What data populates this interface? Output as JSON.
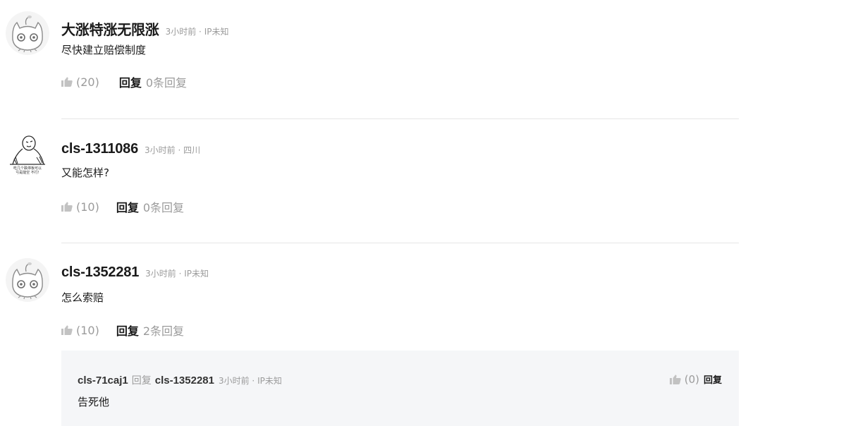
{
  "comments": [
    {
      "username": "大涨特涨无限涨",
      "meta": "3小时前 · IP未知",
      "text": "尽快建立赔偿制度",
      "likes": "(20)",
      "reply_label": "回复",
      "reply_count": "0条回复",
      "avatar_icon": "cat-avatar-icon"
    },
    {
      "username": "cls-1311086",
      "meta": "3小时前 · 四川",
      "text": "又能怎样?",
      "likes": "(10)",
      "reply_label": "回复",
      "reply_count": "0条回复",
      "avatar_icon": "meme-avatar-icon",
      "avatar_caption_line1": "吃几个跌停板可以",
      "avatar_caption_line2": "亏是能空 不行!"
    },
    {
      "username": "cls-1352281",
      "meta": "3小时前 · IP未知",
      "text": "怎么索赔",
      "likes": "(10)",
      "reply_label": "回复",
      "reply_count": "2条回复",
      "avatar_icon": "cat-avatar-icon",
      "subreplies": [
        {
          "username": "cls-71caj1",
          "reply_word": "回复",
          "target_user": "cls-1352281",
          "meta": "3小时前 · IP未知",
          "text": "告死他",
          "likes": "(0)",
          "reply_label": "回复"
        }
      ]
    }
  ],
  "colors": {
    "primary_text": "#1a1a1a",
    "secondary_text": "#9b9b9b",
    "divider": "#e6e6e6",
    "subreply_bg": "#f5f6f8"
  }
}
